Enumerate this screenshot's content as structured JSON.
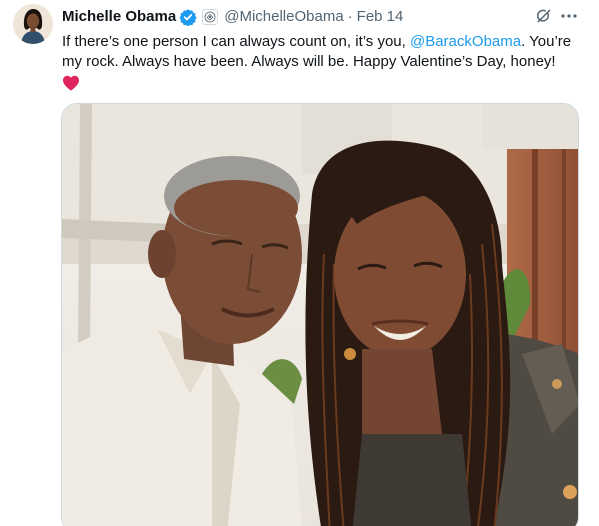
{
  "tweet": {
    "author": {
      "name": "Michelle Obama",
      "handle": "@MichelleObama",
      "verified_icon": "verified-badge-icon",
      "affiliate_icon": "government-seal-icon"
    },
    "separator": "·",
    "date": "Feb 14",
    "text": {
      "before": "If there’s one person I can always count on, it’s you, ",
      "mention": "@BarackObama",
      "after": ". You’re my rock. Always have been. Always will be. Happy Valentine’s Day, honey!"
    },
    "emoji": "heart-emoji",
    "actions": {
      "grok_icon": "grok-icon",
      "more_icon": "more-options-icon"
    },
    "media": {
      "type": "photo",
      "alt": ""
    }
  },
  "colors": {
    "text_primary": "#0f1419",
    "text_secondary": "#536471",
    "link": "#1d9bf0",
    "verified": "#1d9bf0",
    "heart": "#e0245e",
    "border": "#cfd9de"
  }
}
